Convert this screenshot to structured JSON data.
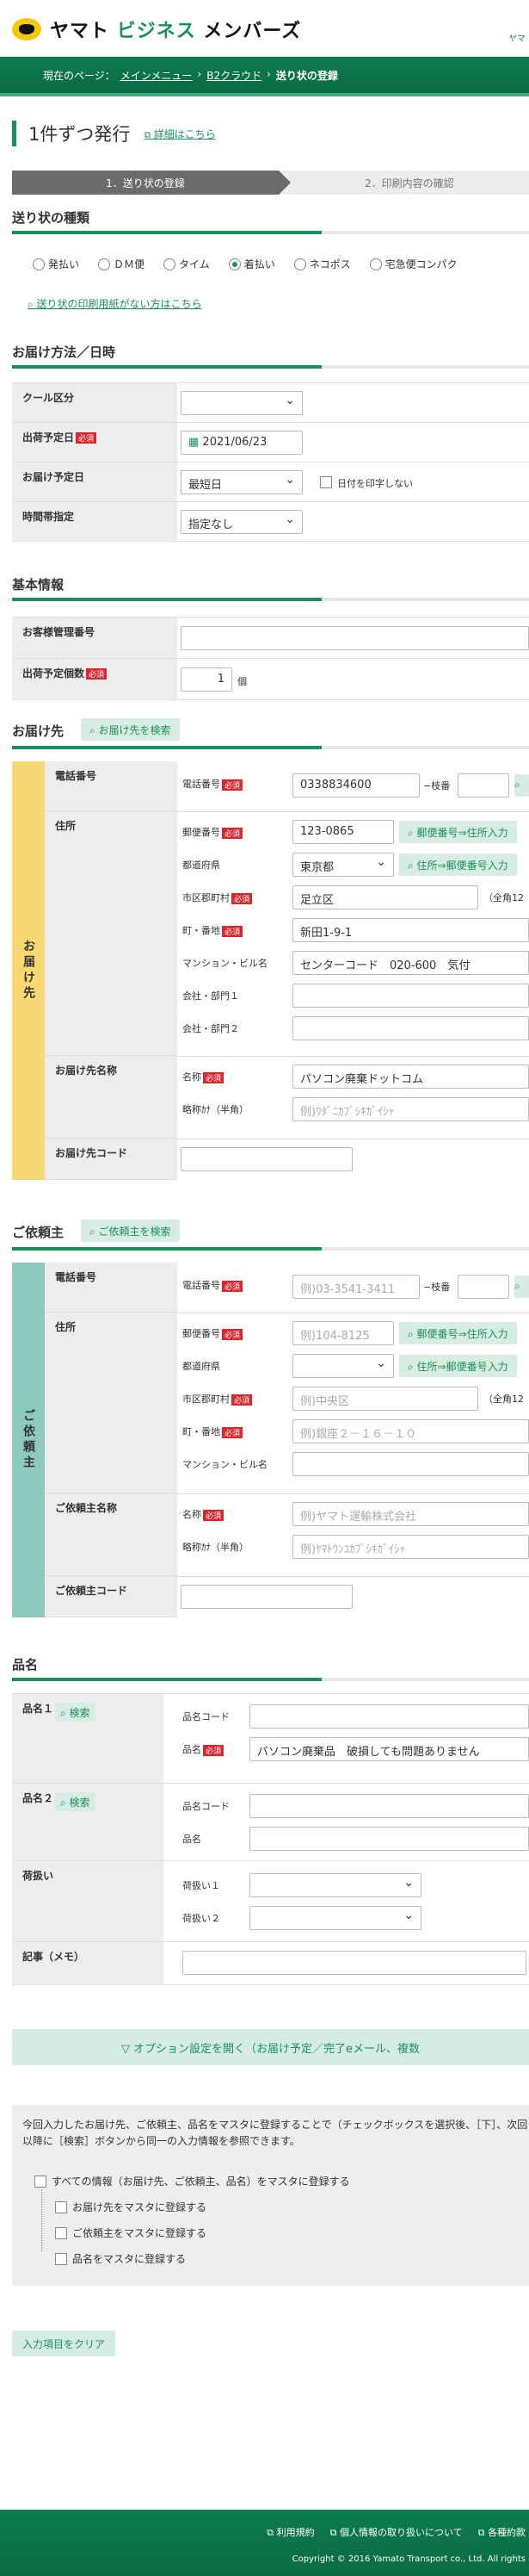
{
  "header": {
    "brand_a": "ヤマト",
    "brand_b": "ビジネス",
    "brand_c": "メンバーズ",
    "right_link": "ヤマ"
  },
  "breadcrumb": {
    "prefix": "現在のページ：",
    "item1": "メインメニュー",
    "sep": "›",
    "item2": "B2クラウド",
    "item3": "送り状の登録"
  },
  "page": {
    "title": "1件ずつ発行",
    "detail_link": "詳細はこちら",
    "step1": "1．送り状の登録",
    "step2": "2．印刷内容の確認"
  },
  "slip_type": {
    "heading": "送り状の種類",
    "options": [
      "発払い",
      "ＤＭ便",
      "タイム",
      "着払い",
      "ネコポス",
      "宅急便コンパク"
    ],
    "selected": "着払い",
    "link": "送り状の印刷用紙がない方はこちら"
  },
  "delivery": {
    "heading": "お届け方法／日時",
    "cool_label": "クール区分",
    "cool_value": "",
    "ship_date_label": "出荷予定日",
    "ship_date_value": "2021/06/23",
    "deliv_date_label": "お届け予定日",
    "deliv_date_value": "最短日",
    "no_print_label": "日付を印字しない",
    "time_label": "時間帯指定",
    "time_value": "指定なし"
  },
  "basic": {
    "heading": "基本情報",
    "customer_no_label": "お客様管理番号",
    "count_label": "出荷予定個数",
    "count_value": "1",
    "count_unit": "個"
  },
  "required": "必須",
  "consignee": {
    "heading": "お届け先",
    "search_btn": "お届け先を検索",
    "side": "お届け先",
    "phone_label": "電話番号",
    "phone_field": "電話番号",
    "phone_value": "0338834600",
    "branch_label": "−枝番",
    "address_label": "住所",
    "zip_field": "郵便番号",
    "zip_value": "123-0865",
    "zip_btn": "郵便番号⇒住所入力",
    "pref_field": "都道府県",
    "pref_value": "東京都",
    "addr_btn": "住所⇒郵便番号入力",
    "city_field": "市区郡町村",
    "city_value": "足立区",
    "city_note": "（全角12",
    "town_field": "町・番地",
    "town_value": "新田1-9-1",
    "bldg_field": "マンション・ビル名",
    "bldg_value": "センターコード　020-600　気付",
    "dept1_field": "会社・部門１",
    "dept2_field": "会社・部門２",
    "name_label": "お届け先名称",
    "name_field": "名称",
    "name_value": "パソコン廃棄ドットコム",
    "kana_field": "略称ｶﾅ（半角）",
    "kana_placeholder": "例)ﾜﾀﾞﾆｶﾌﾞｼｷｶﾞｲｼｬ",
    "code_label": "お届け先コード"
  },
  "shipper": {
    "heading": "ご依頼主",
    "search_btn": "ご依頼主を検索",
    "side": "ご依頼主",
    "phone_label": "電話番号",
    "phone_field": "電話番号",
    "phone_placeholder": "例)03-3541-3411",
    "branch_label": "−枝番",
    "address_label": "住所",
    "zip_field": "郵便番号",
    "zip_placeholder": "例)104-8125",
    "zip_btn": "郵便番号⇒住所入力",
    "pref_field": "都道府県",
    "addr_btn": "住所⇒郵便番号入力",
    "city_field": "市区郡町村",
    "city_placeholder": "例)中央区",
    "city_note": "（全角12",
    "town_field": "町・番地",
    "town_placeholder": "例)銀座２－１６－１０",
    "bldg_field": "マンション・ビル名",
    "name_label": "ご依頼主名称",
    "name_field": "名称",
    "name_placeholder": "例)ヤマト運輸株式会社",
    "kana_field": "略称ｶﾅ（半角）",
    "kana_placeholder": "例)ﾔﾏﾄｳﾝﾕｶﾌﾞｼｷｶﾞｲｼｬ",
    "code_label": "ご依頼主コード"
  },
  "item": {
    "heading": "品名",
    "item1_label": "品名１",
    "item2_label": "品名２",
    "search": "検索",
    "code_field": "品名コード",
    "name_field": "品名",
    "item1_value": "パソコン廃棄品　破損しても問題ありません",
    "handling_label": "荷扱い",
    "handling1": "荷扱い１",
    "handling2": "荷扱い２",
    "memo_label": "記事（メモ）"
  },
  "options_bar": "▽ オプション設定を開く（お届け予定／完了eメール、複数",
  "master": {
    "text": "今回入力したお届け先、ご依頼主、品名をマスタに登録することで（チェックボックスを選択後、［下］、次回以降に［検索］ボタンから同一の入力情報を参照できます。",
    "all": "すべての情報（お届け先、ご依頼主、品名）をマスタに登録する",
    "c1": "お届け先をマスタに登録する",
    "c2": "ご依頼主をマスタに登録する",
    "c3": "品名をマスタに登録する"
  },
  "clear_btn": "入力項目をクリア",
  "footer": {
    "link1": "利用規約",
    "link2": "個人情報の取り扱いについて",
    "link3": "各種約款",
    "copyright": "Copyright © 2016 Yamato Transport co., Ltd. All rights"
  }
}
